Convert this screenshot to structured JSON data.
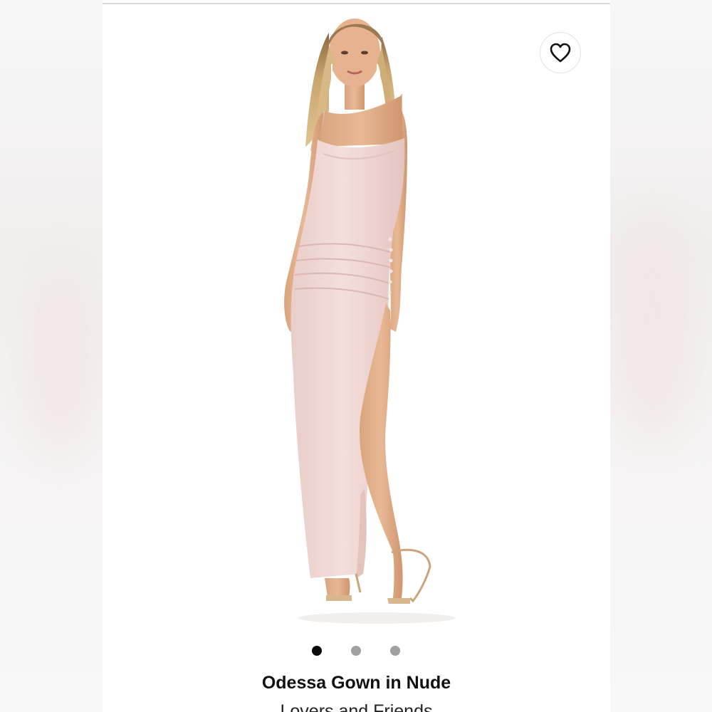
{
  "product": {
    "title": "Odessa Gown in Nude",
    "brand": "Lovers and Friends"
  },
  "gallery": {
    "image_count": 3,
    "active_index": 0
  },
  "icons": {
    "favorite": "heart-outline-icon"
  },
  "colors": {
    "dress": "#f0d6d2",
    "active_dot": "#0a0a0a",
    "inactive_dot": "#a0a0a0"
  }
}
